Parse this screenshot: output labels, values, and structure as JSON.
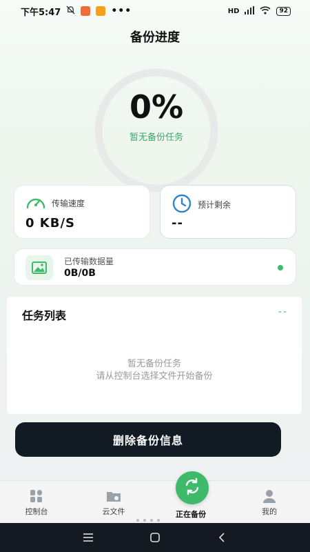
{
  "status_bar": {
    "time": "下午5:47",
    "dots": "•••",
    "network": "HD",
    "battery": "92"
  },
  "header": {
    "title": "备份进度"
  },
  "progress": {
    "percent_text": "0%",
    "value": 0,
    "status": "暂无备份任务"
  },
  "metrics": {
    "speed": {
      "label": "传输速度",
      "value": "0 KB/S",
      "icon": "speedometer-icon"
    },
    "remaining": {
      "label": "预计剩余",
      "value": "--",
      "icon": "clock-icon"
    },
    "transferred": {
      "label": "已传输数据量",
      "value": "0B/0B",
      "icon": "image-icon"
    }
  },
  "task_list": {
    "title": "任务列表",
    "count": "--",
    "empty_line1": "暂无备份任务",
    "empty_line2": "请从控制台选择文件开始备份"
  },
  "actions": {
    "delete_label": "删除备份信息"
  },
  "bottom_nav": {
    "items": [
      {
        "label": "控制台",
        "icon": "dashboard-icon"
      },
      {
        "label": "云文件",
        "icon": "cloud-folder-icon"
      },
      {
        "label": "正在备份",
        "icon": "sync-icon",
        "active": true
      },
      {
        "label": "我的",
        "icon": "user-icon"
      }
    ]
  },
  "colors": {
    "accent": "#3fba6b",
    "button_dark": "#121a24",
    "ring_track": "#e8eaea"
  }
}
